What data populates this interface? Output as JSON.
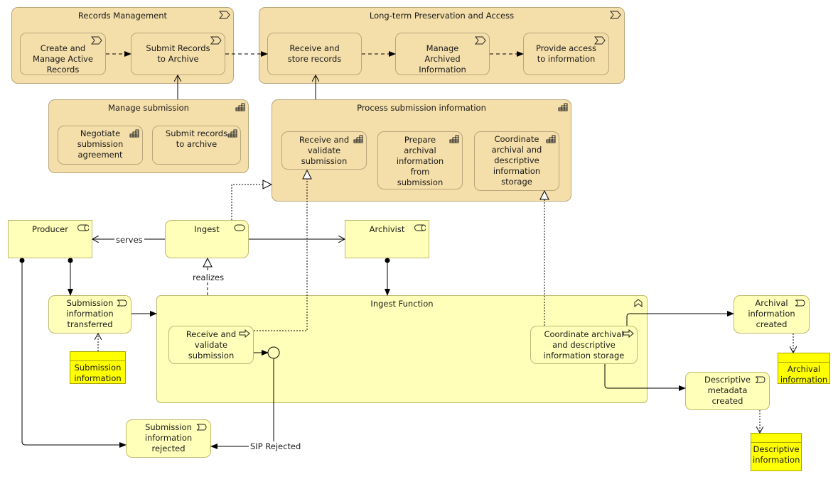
{
  "colors": {
    "strategy_tan": "#f4dea9",
    "business_yellow": "#ffffb9",
    "data_yellow": "#ffff00"
  },
  "value_streams": {
    "records_management": {
      "title": "Records Management",
      "stages": [
        "Create and Manage Active Records",
        "Submit Records to Archive"
      ]
    },
    "ltpa": {
      "title": "Long-term Preservation and Access",
      "stages": [
        "Receive and store records",
        "Manage Archived Information",
        "Provide access to information"
      ]
    }
  },
  "capabilities": {
    "manage_submission": {
      "title": "Manage submission",
      "children": [
        "Negotiate submission agreement",
        "Submit records to archive"
      ]
    },
    "process_submission": {
      "title": "Process submission information",
      "children": [
        "Receive and validate submission",
        "Prepare archival information from submission",
        "Coordinate archival and descriptive information storage"
      ]
    }
  },
  "roles": {
    "producer": "Producer",
    "archivist": "Archivist"
  },
  "service": {
    "ingest": "Ingest"
  },
  "function": {
    "title": "Ingest Function",
    "processes": [
      "Receive and validate submission",
      "Coordinate archival and descriptive information storage"
    ]
  },
  "events": {
    "transferred": "Submission information transferred",
    "rejected": "Submission information rejected",
    "archival_created": "Archival information created",
    "descriptive_created": "Descriptive metadata created"
  },
  "data_objects": {
    "submission": "Submission information",
    "archival": "Archival information",
    "descriptive": "Descriptive information"
  },
  "relation_labels": {
    "serves": "serves",
    "realizes": "realizes",
    "sip_rejected": "SIP Rejected"
  },
  "icons": {
    "value_stream": "chevron-icon",
    "capability": "stair-grid-icon",
    "role": "cylinder-icon",
    "service": "pill-icon",
    "event": "event-icon",
    "process": "arrow-icon",
    "function": "function-chevron-icon"
  }
}
